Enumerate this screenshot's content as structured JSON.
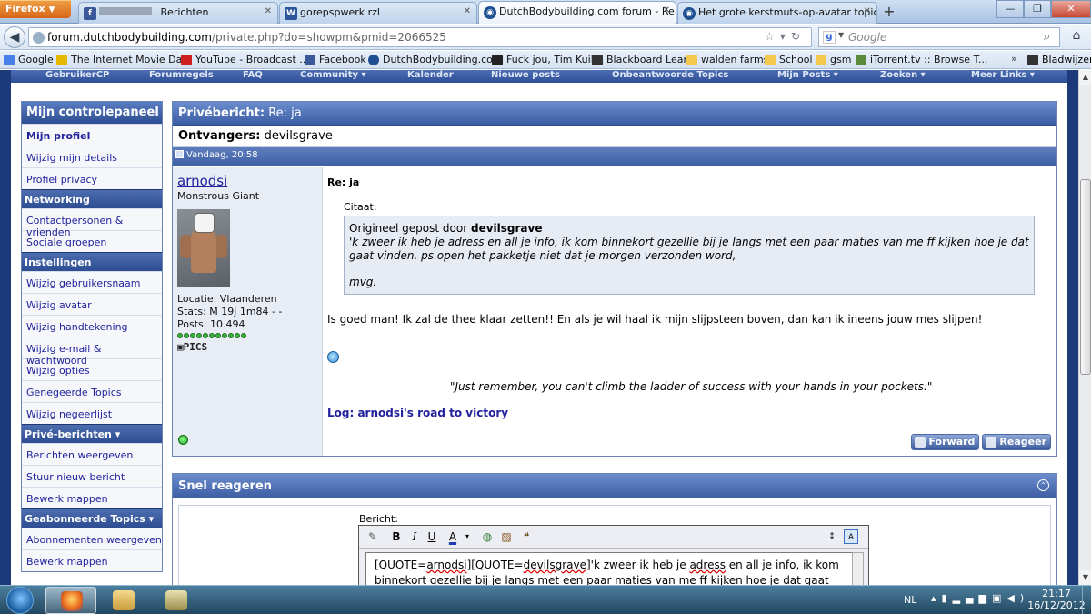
{
  "browser": {
    "app_button": "Firefox",
    "tabs": [
      {
        "label": "Berichten",
        "icon": "facebook-icon"
      },
      {
        "label": "gorepspwerk rzl",
        "icon": "word-icon"
      },
      {
        "label": "DutchBodybuilding.com forum - Re: ja",
        "icon": "dbb-icon",
        "active": true
      },
      {
        "label": "Het grote kerstmuts-op-avatar topic ...",
        "icon": "dbb-icon"
      }
    ],
    "url_domain": "forum.dutchbodybuilding.com",
    "url_path": "/private.php?do=showpm&pmid=2066525",
    "search_placeholder": "Google",
    "bookmarks": [
      "Google",
      "The Internet Movie Da...",
      "YouTube - Broadcast ...",
      "Facebook",
      "DutchBodybuilding.co...",
      "Fuck jou, Tim Kuik",
      "Blackboard Learn",
      "walden farms",
      "School",
      "gsm",
      "iTorrent.tv :: Browse T..."
    ],
    "bookmarks_overflow": "»",
    "bookmarks_right": "Bladwijzers"
  },
  "forum": {
    "top_nav": [
      "GebruikerCP",
      "Forumregels",
      "FAQ",
      "Community ▾",
      "Kalender",
      "Nieuwe posts",
      "Onbeantwoorde Topics",
      "Mijn Posts ▾",
      "Zoeken ▾",
      "Meer Links ▾"
    ],
    "sidebar": {
      "title": "Mijn controlepaneel",
      "sections": [
        {
          "header": "",
          "links": [
            "Mijn profiel",
            "Wijzig mijn details",
            "Profiel privacy"
          ]
        },
        {
          "header": "Networking",
          "links": [
            "Contactpersonen & vrienden",
            "Sociale groepen"
          ]
        },
        {
          "header": "Instellingen",
          "links": [
            "Wijzig gebruikersnaam",
            "Wijzig avatar",
            "Wijzig handtekening",
            "Wijzig e-mail & wachtwoord",
            "Wijzig opties",
            "Genegeerde Topics",
            "Wijzig negeerlijst"
          ]
        },
        {
          "header": "Privé-berichten ▾",
          "links": [
            "Berichten weergeven",
            "Stuur nieuw bericht",
            "Bewerk mappen"
          ]
        },
        {
          "header": "Geabonneerde Topics ▾",
          "links": [
            "Abonnementen weergeven",
            "Bewerk mappen"
          ]
        }
      ]
    },
    "pm": {
      "title_label": "Privébericht:",
      "title_value": "Re: ja",
      "recipients_label": "Ontvangers:",
      "recipients_value": "devilsgrave",
      "timestamp": "Vandaag, 20:58",
      "user": {
        "name": "arnodsi",
        "rank": "Monstrous Giant",
        "location": "Locatie: Vlaanderen",
        "stats": "Stats: M 19j 1m84 - -",
        "posts": "Posts: 10.494",
        "reputation_pips": 11,
        "badge": "PICS"
      },
      "post_title": "Re: ja",
      "quote_label": "Citaat:",
      "quote_by_prefix": "Origineel gepost door",
      "quote_author": "devilsgrave",
      "quote_text": "'k zweer ik heb je adress en all je info, ik kom binnekort gezellie bij je langs met een paar maties van me ff kijken hoe je dat gaat vinden. ps.open het pakketje niet dat je morgen verzonden word,",
      "quote_signoff": "mvg.",
      "reply_text": "Is goed man! Ik zal de thee klaar zetten!! En als je wil haal ik mijn slijpsteen boven, dan kan ik ineens jouw mes slijpen!",
      "signature_quote": "\"Just remember, you can't climb the ladder of success with your hands in your pockets.\"",
      "signature_link": "Log: arnodsi's road to victory",
      "buttons": {
        "forward": "Forward",
        "reply": "Reageer"
      }
    },
    "quick_reply": {
      "title": "Snel reageren",
      "message_label": "Bericht:",
      "editor_text_line1_a": "[QUOTE=",
      "editor_text_line1_user": "arnodsi",
      "editor_text_line1_b": "][QUOTE=",
      "editor_text_line1_user2": "devilsgrave",
      "editor_text_line1_c": "]'k zweer ik heb je",
      "editor_text_line1_adress": "adress",
      "editor_text_line1_d": "en all je info, ik kom",
      "editor_text_line2": "binnekort gezellie bij je langs met een paar maties van me ff kijken hoe je dat gaat"
    }
  },
  "taskbar": {
    "language": "NL",
    "time": "21:17",
    "date": "16/12/2012"
  }
}
